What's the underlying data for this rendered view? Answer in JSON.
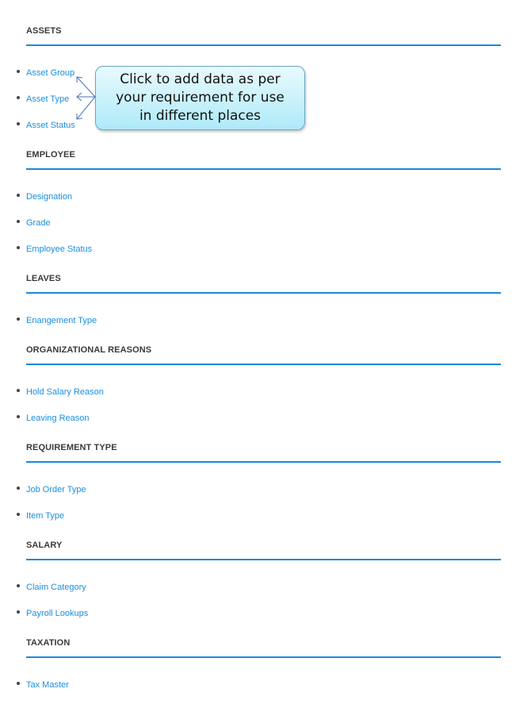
{
  "sections": [
    {
      "title": "ASSETS",
      "items": [
        "Asset Group",
        "Asset Type",
        "Asset Status"
      ]
    },
    {
      "title": "EMPLOYEE",
      "items": [
        "Designation",
        "Grade",
        "Employee Status"
      ]
    },
    {
      "title": "LEAVES",
      "items": [
        "Enangement Type"
      ]
    },
    {
      "title": "ORGANIZATIONAL REASONS",
      "items": [
        "Hold Salary Reason",
        "Leaving Reason"
      ]
    },
    {
      "title": "REQUIREMENT TYPE",
      "items": [
        "Job Order Type",
        "Item Type"
      ]
    },
    {
      "title": "SALARY",
      "items": [
        "Claim Category",
        "Payroll Lookups"
      ]
    },
    {
      "title": "TAXATION",
      "items": [
        "Tax Master"
      ]
    }
  ],
  "callout": {
    "text": "Click to add data as per your requirement for use in different places"
  },
  "colors": {
    "accent": "#1e88d6",
    "link": "#1a8ee0",
    "heading": "#3a3a3a",
    "callout_fill": "#aeeaf9"
  }
}
